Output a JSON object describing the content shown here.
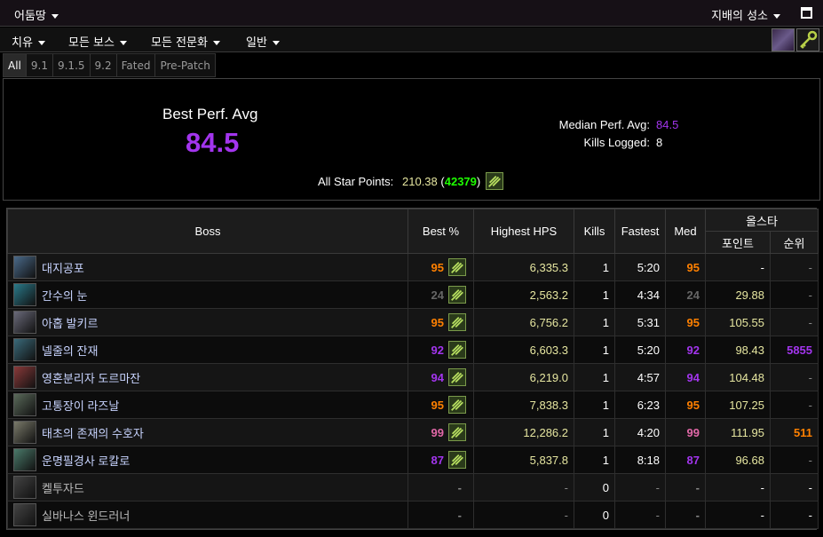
{
  "topbar": {
    "region": "어둠땅",
    "zone": "지배의 성소"
  },
  "filters": {
    "role": "치유",
    "bosses": "모든 보스",
    "spec": "모든 전문화",
    "mode": "일반"
  },
  "tabs": [
    "All",
    "9.1",
    "9.1.5",
    "9.2",
    "Fated",
    "Pre-Patch"
  ],
  "summary": {
    "best_label": "Best Perf. Avg",
    "best_value": "84.5",
    "median_label": "Median Perf. Avg:",
    "median_value": "84.5",
    "kills_label": "Kills Logged:",
    "kills_value": "8",
    "star_label": "All Star Points:",
    "star_points": "210.38",
    "star_rank": "42379",
    "star_open": "(",
    "star_close": ")"
  },
  "table": {
    "headers": {
      "boss": "Boss",
      "best": "Best %",
      "hps": "Highest HPS",
      "kills": "Kills",
      "fastest": "Fastest",
      "med": "Med",
      "allstar": "올스타",
      "points": "포인트",
      "rank": "순위"
    },
    "rows": [
      {
        "boss": "대지공포",
        "best": "95",
        "best_color": "#ff8000",
        "hps": "6,335.3",
        "kills": "1",
        "fastest": "5:20",
        "med": "95",
        "med_color": "#ff8000",
        "points": "-",
        "rank": "-",
        "rank_color": "#888888"
      },
      {
        "boss": "간수의 눈",
        "best": "24",
        "best_color": "#666666",
        "hps": "2,563.2",
        "kills": "1",
        "fastest": "4:34",
        "med": "24",
        "med_color": "#666666",
        "points": "29.88",
        "rank": "-",
        "rank_color": "#888888"
      },
      {
        "boss": "아홉 발키르",
        "best": "95",
        "best_color": "#ff8000",
        "hps": "6,756.2",
        "kills": "1",
        "fastest": "5:31",
        "med": "95",
        "med_color": "#ff8000",
        "points": "105.55",
        "rank": "-",
        "rank_color": "#888888"
      },
      {
        "boss": "넬줄의 잔재",
        "best": "92",
        "best_color": "#a335ee",
        "hps": "6,603.3",
        "kills": "1",
        "fastest": "5:20",
        "med": "92",
        "med_color": "#a335ee",
        "points": "98.43",
        "rank": "5855",
        "rank_color": "#a335ee"
      },
      {
        "boss": "영혼분리자 도르마잔",
        "best": "94",
        "best_color": "#a335ee",
        "hps": "6,219.0",
        "kills": "1",
        "fastest": "4:57",
        "med": "94",
        "med_color": "#a335ee",
        "points": "104.48",
        "rank": "-",
        "rank_color": "#888888"
      },
      {
        "boss": "고통장이 라즈날",
        "best": "95",
        "best_color": "#ff8000",
        "hps": "7,838.3",
        "kills": "1",
        "fastest": "6:23",
        "med": "95",
        "med_color": "#ff8000",
        "points": "107.25",
        "rank": "-",
        "rank_color": "#888888"
      },
      {
        "boss": "태초의 존재의 수호자",
        "best": "99",
        "best_color": "#e268a8",
        "hps": "12,286.2",
        "kills": "1",
        "fastest": "4:20",
        "med": "99",
        "med_color": "#e268a8",
        "points": "111.95",
        "rank": "511",
        "rank_color": "#ff8000"
      },
      {
        "boss": "운명필경사 로칼로",
        "best": "87",
        "best_color": "#a335ee",
        "hps": "5,837.8",
        "kills": "1",
        "fastest": "8:18",
        "med": "87",
        "med_color": "#a335ee",
        "points": "96.68",
        "rank": "-",
        "rank_color": "#888888"
      },
      {
        "boss": "켈투자드",
        "best": "-",
        "best_color": "#888888",
        "hps": "-",
        "kills": "0",
        "fastest": "-",
        "med": "-",
        "med_color": "#888888",
        "points": "-",
        "rank": "-",
        "rank_color": "#ffffff"
      },
      {
        "boss": "실바나스 윈드러너",
        "best": "-",
        "best_color": "#888888",
        "hps": "-",
        "kills": "0",
        "fastest": "-",
        "med": "-",
        "med_color": "#888888",
        "points": "-",
        "rank": "-",
        "rank_color": "#ffffff"
      }
    ]
  },
  "colors": {
    "legendary": "#ff8000",
    "epic": "#a335ee",
    "astounding": "#e268a8",
    "common": "#666666",
    "rank_green": "#1eff00"
  }
}
